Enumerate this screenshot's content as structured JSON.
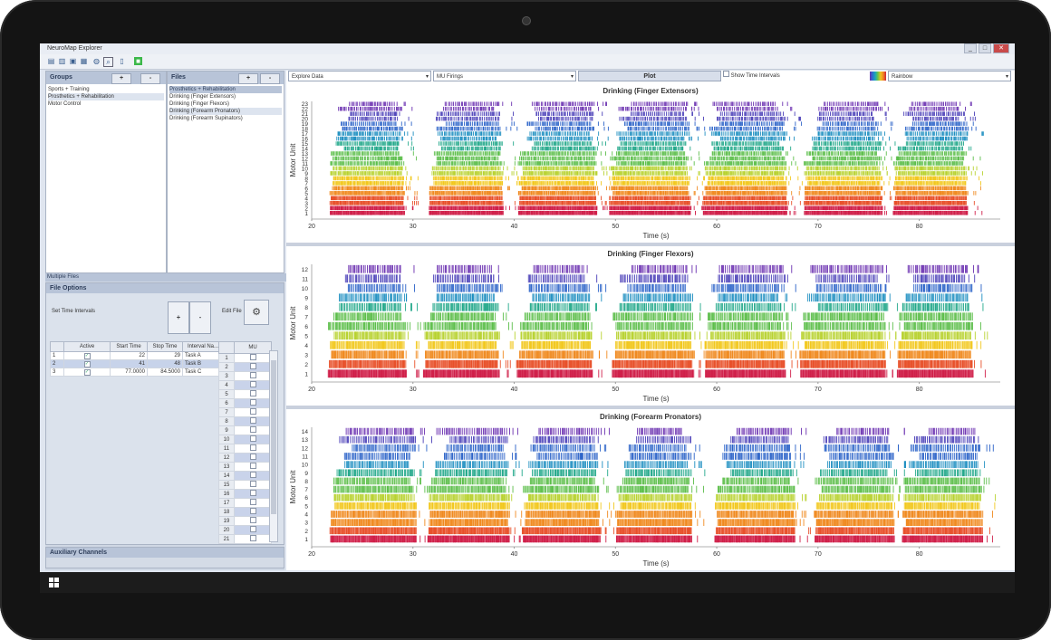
{
  "window": {
    "title": "NeuroMap Explorer",
    "controls": [
      "_",
      "□",
      "✕"
    ]
  },
  "toolbar": {
    "icons": [
      "new-icon",
      "open-icon",
      "save-icon",
      "grid-icon",
      "globe-icon",
      "zoom-icon",
      "device-icon",
      "green-icon"
    ]
  },
  "groups": {
    "title": "Groups",
    "add": "+",
    "remove": "-",
    "items": [
      "Sports + Training",
      "Prosthetics + Rehabilitation",
      "Motor Control"
    ],
    "selected_index": 1
  },
  "files": {
    "title": "Files",
    "add": "+",
    "remove": "-",
    "header": "Prosthetics + Rehabilitation",
    "items": [
      "Drinking (Finger Extensors)",
      "Drinking (Finger Flexors)",
      "Drinking (Forearm Pronators)",
      "Drinking (Forearm Supinators)"
    ],
    "selected_index": 2
  },
  "multiple_files": "Multiple Files",
  "file_options": {
    "title": "File Options",
    "set_time_intervals": "Set Time Intervals",
    "plus": "+",
    "minus": "-",
    "edit_file": "Edit File",
    "interval_table": {
      "headers": [
        "",
        "Active",
        "Start Time",
        "Stop Time",
        "Interval Na..."
      ],
      "rows": [
        {
          "n": "1",
          "active": "✓",
          "start": "22",
          "stop": "29",
          "name": "Task A"
        },
        {
          "n": "2",
          "active": "✓",
          "start": "41",
          "stop": "48",
          "name": "Task B"
        },
        {
          "n": "3",
          "active": "✓",
          "start": "77.0000",
          "stop": "84.5000",
          "name": "Task C"
        }
      ],
      "selected_index": 1
    },
    "mu_table": {
      "header": "MU",
      "rows": [
        "1",
        "2",
        "3",
        "4",
        "5",
        "6",
        "7",
        "8",
        "9",
        "10",
        "11",
        "12",
        "13",
        "14",
        "15",
        "16",
        "17",
        "18",
        "19",
        "20",
        "21"
      ]
    }
  },
  "auxiliary_channels": "Auxiliary Channels",
  "controls": {
    "explore_data": "Explore Data",
    "mu_firings": "MU Firings",
    "plot": "Plot",
    "show_time_intervals": "Show Time Intervals",
    "colormap": "Rainbow"
  },
  "colors": {
    "rainbow": [
      "#d0204a",
      "#e8502a",
      "#f08a20",
      "#f2c81e",
      "#b8d230",
      "#5cbe4a",
      "#22a88a",
      "#1c8ec0",
      "#2a62c8",
      "#4a3fb8",
      "#6a2fb0"
    ]
  },
  "chart_data": [
    {
      "type": "raster",
      "title": "Drinking (Finger Extensors)",
      "xlabel": "Time (s)",
      "ylabel": "Motor Unit",
      "xlim": [
        20,
        88
      ],
      "xticks": [
        20,
        30,
        40,
        50,
        60,
        70,
        80
      ],
      "units": 23,
      "bursts": [
        [
          21.8,
          29.2
        ],
        [
          31.6,
          39.0
        ],
        [
          40.4,
          48.2
        ],
        [
          49.4,
          57.4
        ],
        [
          58.6,
          67.0
        ],
        [
          68.6,
          76.4
        ],
        [
          77.4,
          84.8
        ]
      ]
    },
    {
      "type": "raster",
      "title": "Drinking (Finger Flexors)",
      "xlabel": "Time (s)",
      "ylabel": "Motor Unit",
      "xlim": [
        20,
        88
      ],
      "xticks": [
        20,
        30,
        40,
        50,
        60,
        70,
        80
      ],
      "units": 12,
      "bursts": [
        [
          21.6,
          29.4
        ],
        [
          31.0,
          38.6
        ],
        [
          40.2,
          47.8
        ],
        [
          49.6,
          57.8
        ],
        [
          58.8,
          66.8
        ],
        [
          68.2,
          76.8
        ],
        [
          77.8,
          85.4
        ]
      ]
    },
    {
      "type": "raster",
      "title": "Drinking (Forearm Pronators)",
      "xlabel": "Time (s)",
      "ylabel": "Motor Unit",
      "xlim": [
        20,
        88
      ],
      "xticks": [
        20,
        30,
        40,
        50,
        60,
        70,
        80
      ],
      "units": 14,
      "bursts": [
        [
          21.8,
          30.4
        ],
        [
          31.4,
          39.6
        ],
        [
          40.8,
          48.6
        ],
        [
          50.0,
          57.6
        ],
        [
          59.8,
          67.8
        ],
        [
          69.6,
          77.6
        ],
        [
          78.4,
          86.4
        ]
      ]
    }
  ],
  "taskbar": {
    "start": "windows-logo"
  }
}
